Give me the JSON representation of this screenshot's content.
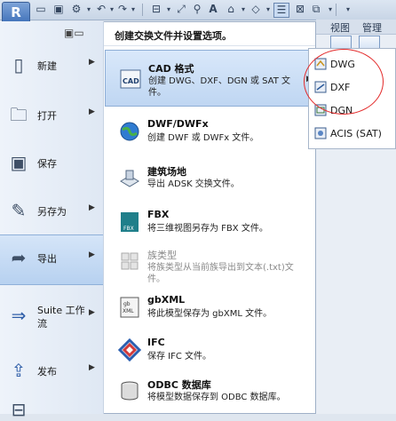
{
  "app": {
    "logo": "R"
  },
  "ribbon": {
    "tabs": [
      "视图",
      "管理"
    ]
  },
  "menu": {
    "left_items": [
      {
        "label": "新建",
        "icon": "new-file-icon",
        "has_arrow": true
      },
      {
        "label": "打开",
        "icon": "open-folder-icon",
        "has_arrow": true
      },
      {
        "label": "保存",
        "icon": "save-icon",
        "has_arrow": false
      },
      {
        "label": "另存为",
        "icon": "save-as-icon",
        "has_arrow": true
      },
      {
        "label": "导出",
        "icon": "export-icon",
        "has_arrow": true,
        "selected": true
      },
      {
        "label": "Suite 工作流",
        "icon": "suite-workflow-icon",
        "has_arrow": true
      },
      {
        "label": "发布",
        "icon": "publish-icon",
        "has_arrow": true
      }
    ],
    "right_header": "创建交换文件并设置选项。",
    "right_items": [
      {
        "title": "CAD 格式",
        "desc": "创建 DWG、DXF、DGN 或 SAT 文件。",
        "icon": "cad-icon",
        "has_arrow": true,
        "selected": true
      },
      {
        "title": "DWF/DWFx",
        "desc": "创建 DWF 或 DWFx 文件。",
        "icon": "dwf-globe-icon"
      },
      {
        "title": "建筑场地",
        "desc": "导出 ADSK 交换文件。",
        "icon": "site-icon"
      },
      {
        "title": "FBX",
        "desc": "将三维视图另存为 FBX 文件。",
        "icon": "fbx-icon"
      },
      {
        "title": "族类型",
        "desc": "将族类型从当前族导出到文本(.txt)文件。",
        "icon": "family-types-icon",
        "disabled": true
      },
      {
        "title": "gbXML",
        "desc": "将此模型保存为 gbXML 文件。",
        "icon": "gbxml-icon"
      },
      {
        "title": "IFC",
        "desc": "保存 IFC 文件。",
        "icon": "ifc-icon"
      },
      {
        "title": "ODBC 数据库",
        "desc": "将模型数据保存到 ODBC 数据库。",
        "icon": "database-icon"
      }
    ],
    "submenu": [
      "DWG",
      "DXF",
      "DGN",
      "ACIS (SAT)"
    ]
  },
  "colors": {
    "highlight": "#e32a2a",
    "selection": "#bfd6f2",
    "accent": "#3d6fb8"
  }
}
